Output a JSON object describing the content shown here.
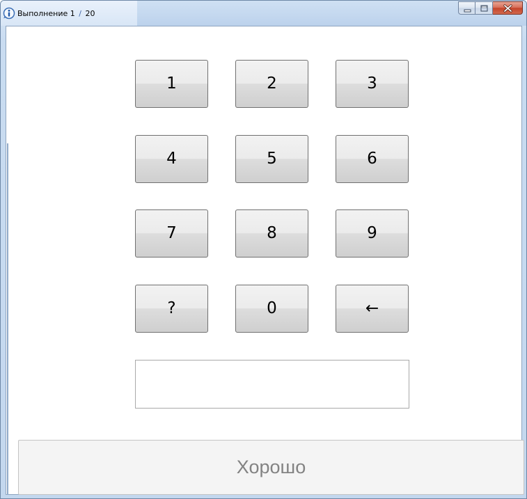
{
  "window": {
    "title_prefix": "Выполнение",
    "current_step": "1",
    "separator": "/",
    "total_steps": "20",
    "icon": "info-icon"
  },
  "caption_buttons": {
    "minimize_icon": "minimize-icon",
    "maximize_icon": "maximize-icon",
    "close_icon": "close-icon"
  },
  "keypad": {
    "keys": [
      "1",
      "2",
      "3",
      "4",
      "5",
      "6",
      "7",
      "8",
      "9",
      "?",
      "0",
      "←"
    ]
  },
  "answer_input": {
    "value": "",
    "placeholder": ""
  },
  "ok_button": {
    "label": "Хорошо",
    "text_color": "#838383"
  }
}
